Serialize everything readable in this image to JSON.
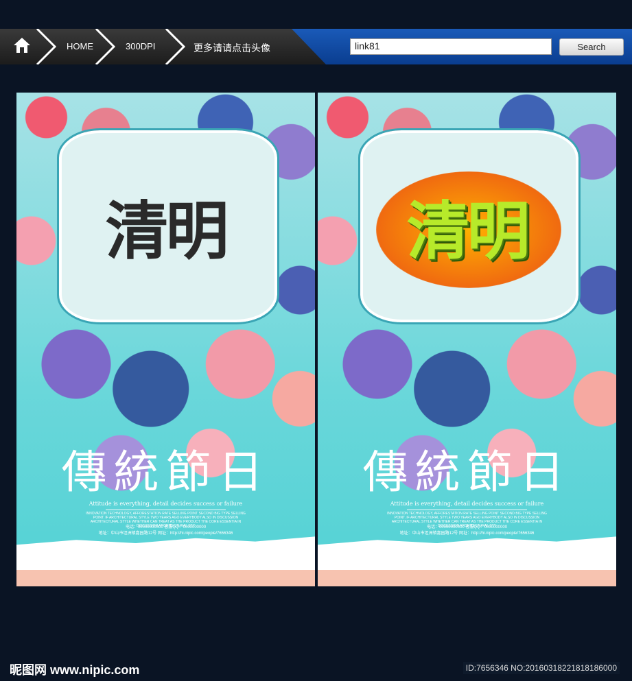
{
  "nav": {
    "home_icon": "home-icon",
    "crumbs": [
      "HOME",
      "300DPI",
      "更多请请点击头像"
    ]
  },
  "search": {
    "value": "link81",
    "button": "Search"
  },
  "posters": [
    {
      "title": "清明",
      "subtitle": "傳統節日",
      "tagline": "Attitude is everything, detail decides success or failure",
      "body": "INNOVATION TECHNOLOGY, AFFORESTATION RATE SELLING POINT SECOND BIG TYPE SELLING POINT. IF ARCHITECTURAL STYLE TWO YEARS AGO EVERYBODY ALSO IN DISCUSSION ARCHITECTURAL STYLE WHETHER CAN TREAT AS THE PRODUCT THE CORE ESSENTIA IN DISCUSSION ARCHITECTURAL STY",
      "phone": "电话：00000000000   客服QQ：0000000000",
      "address": "地址：中山市坦洲镇嘉园路12号   网址：http://hi.nipic.com/people/7656346"
    },
    {
      "title": "清明",
      "subtitle": "傳統節日",
      "tagline": "Attitude is everything, detail decides success or failure",
      "body": "INNOVATION TECHNOLOGY, AFFORESTATION RATE SELLING POINT SECOND BIG TYPE SELLING POINT. IF ARCHITECTURAL STYLE TWO YEARS AGO EVERYBODY ALSO IN DISCUSSION ARCHITECTURAL STYLE WHETHER CAN TREAT AS THE PRODUCT THE CORE ESSENTIA IN DISCUSSION ARCHITECTURAL STY",
      "phone": "电话：00000000000   客服QQ：0000000000",
      "address": "地址：中山市坦洲镇嘉园路12号   网址：http://hi.nipic.com/people/7656346"
    }
  ],
  "footer": {
    "logo": "昵图网 www.nipic.com",
    "id": "ID:7656346 NO:20160318221818186000"
  }
}
